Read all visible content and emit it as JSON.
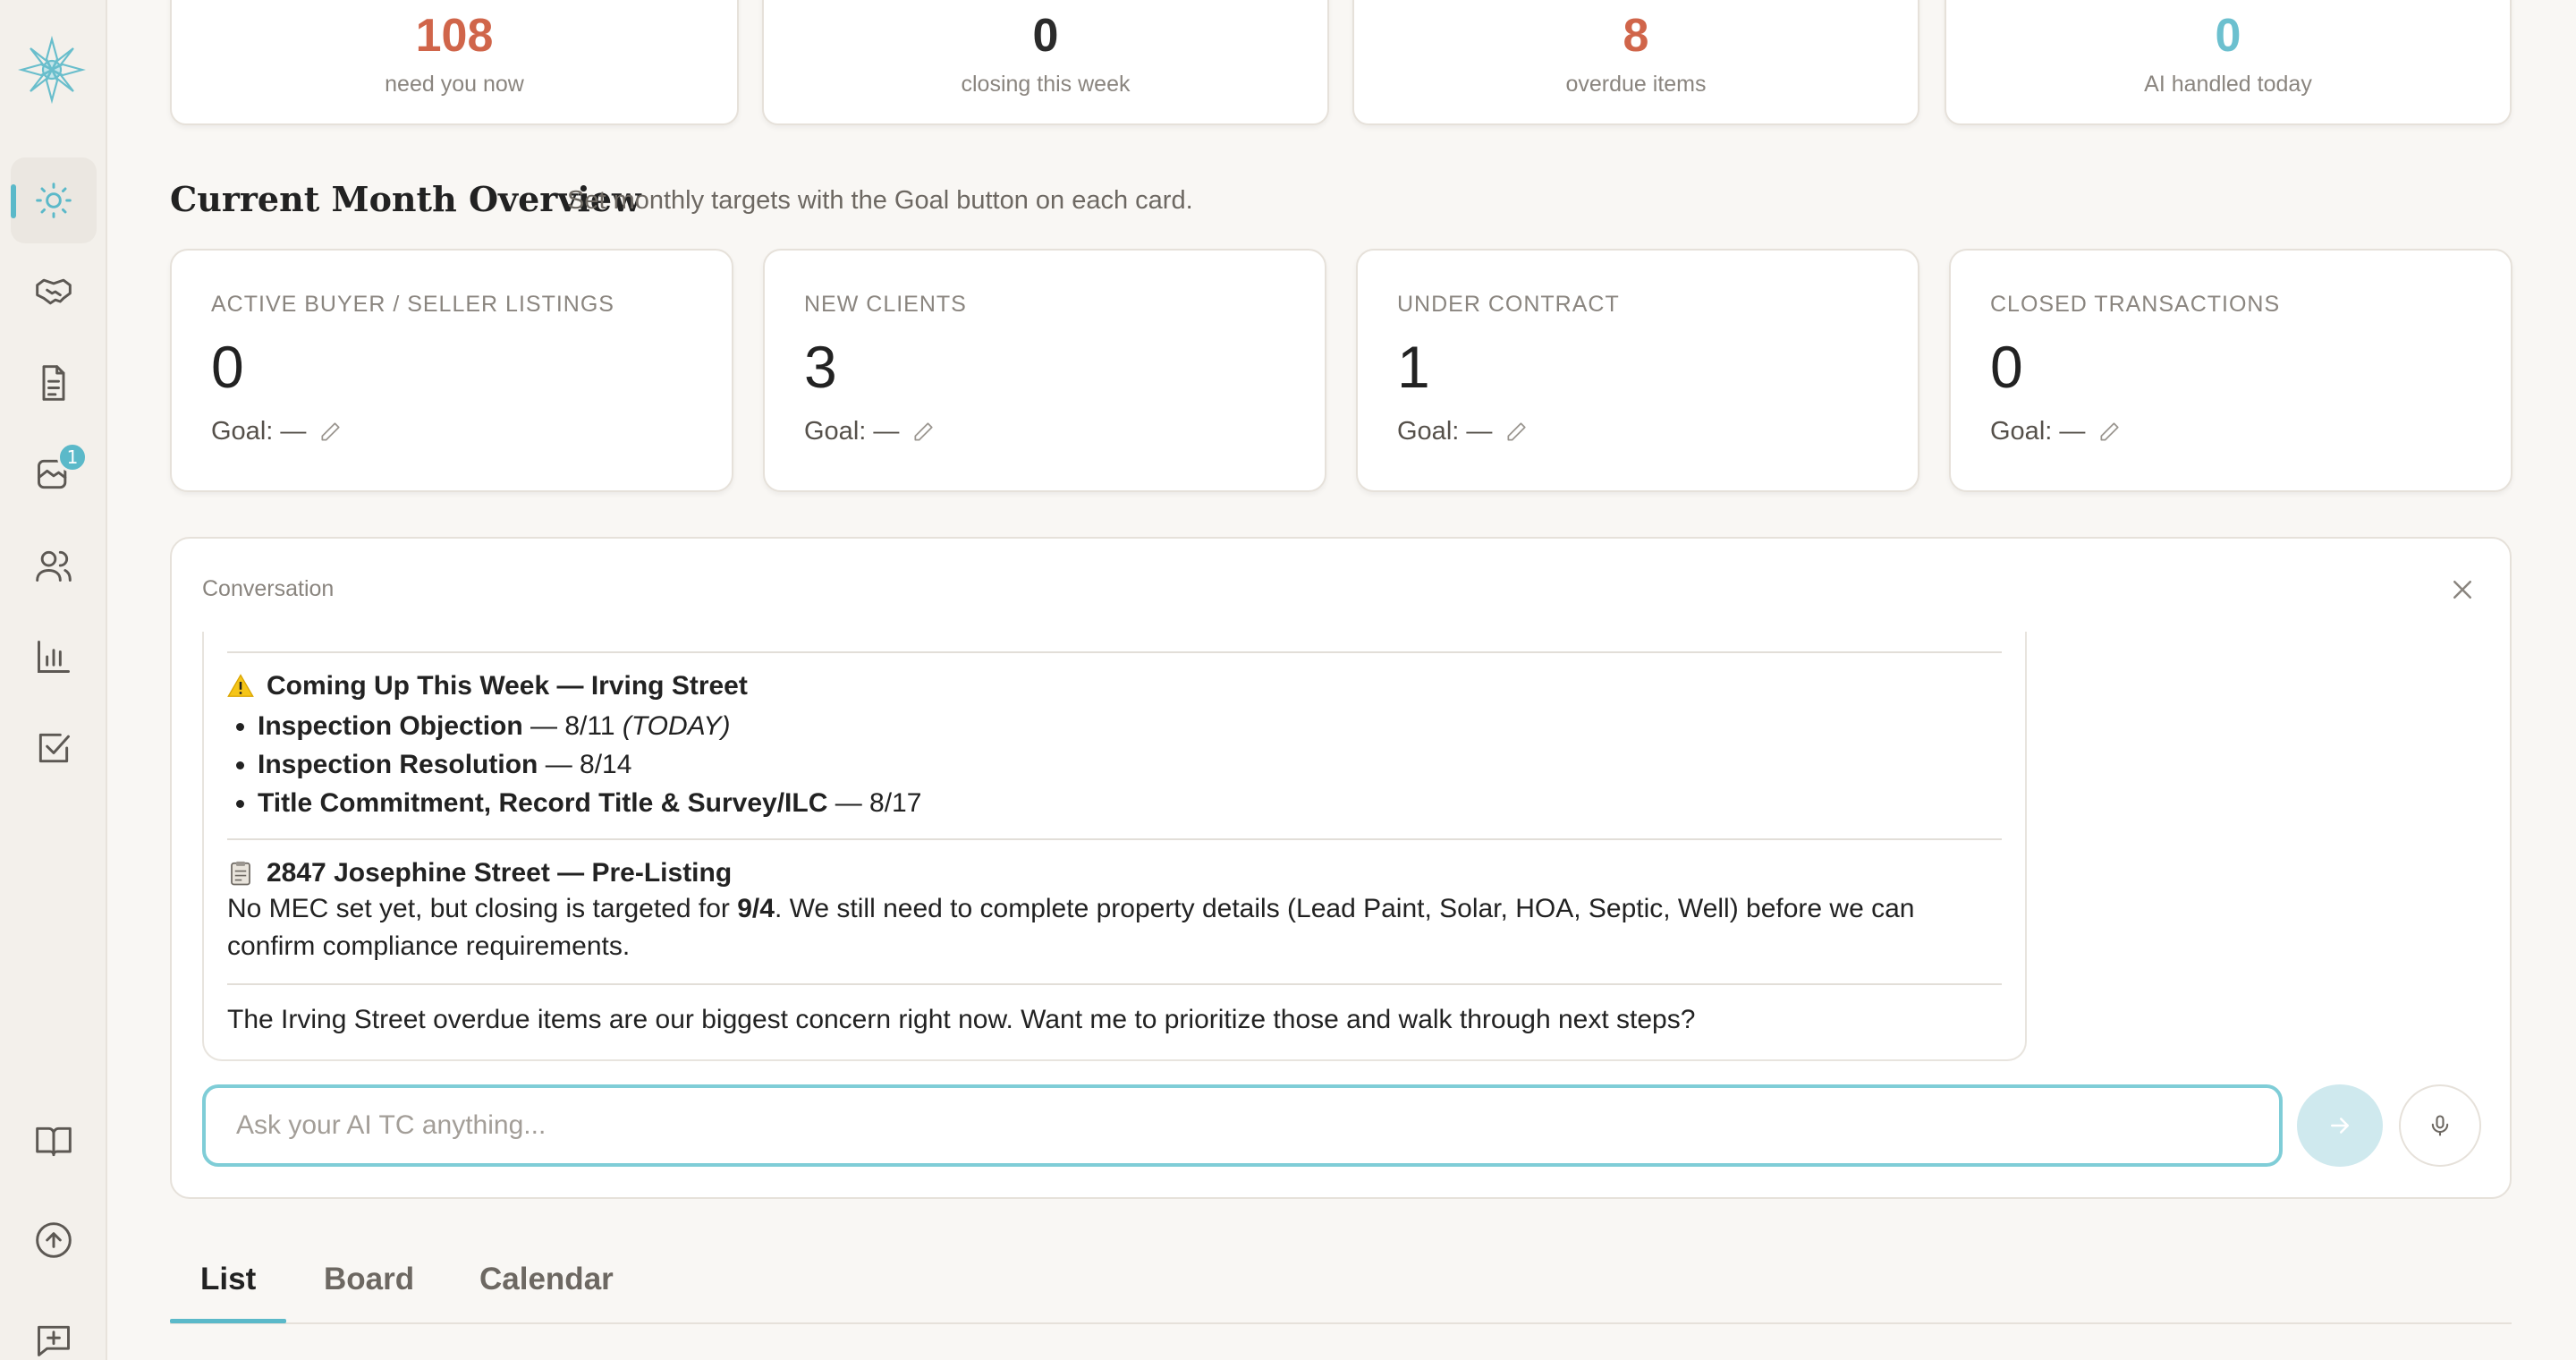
{
  "stats": [
    {
      "value": "108",
      "label": "need you now",
      "color": "#d0654a"
    },
    {
      "value": "0",
      "label": "closing this week",
      "color": "#2b2b2b"
    },
    {
      "value": "8",
      "label": "overdue items",
      "color": "#d0654a"
    },
    {
      "value": "0",
      "label": "AI handled today",
      "color": "#6cc0cf"
    }
  ],
  "overview": {
    "title": "Current Month Overview",
    "subtitle": "Set monthly targets with the Goal button on each card."
  },
  "metrics": [
    {
      "label": "ACTIVE BUYER / SELLER LISTINGS",
      "value": "0",
      "goal": "Goal: —"
    },
    {
      "label": "NEW CLIENTS",
      "value": "3",
      "goal": "Goal: —"
    },
    {
      "label": "UNDER CONTRACT",
      "value": "1",
      "goal": "Goal: —"
    },
    {
      "label": "CLOSED TRANSACTIONS",
      "value": "0",
      "goal": "Goal: —"
    }
  ],
  "sidebar": {
    "inbox_badge": "1"
  },
  "conversation": {
    "title": "Conversation",
    "section1": {
      "heading": "Coming Up This Week — Irving Street",
      "items": [
        {
          "name": "Inspection Objection",
          "date": " — 8/11 ",
          "note": "(TODAY)"
        },
        {
          "name": "Inspection Resolution",
          "date": " — 8/14",
          "note": ""
        },
        {
          "name": "Title Commitment, Record Title & Survey/ILC",
          "date": " — 8/17",
          "note": ""
        }
      ]
    },
    "section2": {
      "heading": "2847 Josephine Street — Pre-Listing",
      "text_a": "No MEC set yet, but closing is targeted for ",
      "text_bold": "9/4",
      "text_b": ". We still need to complete property details (Lead Paint, Solar, HOA, Septic, Well) before we can confirm compliance requirements."
    },
    "closing": "The Irving Street overdue items are our biggest concern right now. Want me to prioritize those and walk through next steps?",
    "input_placeholder": "Ask your AI TC anything..."
  },
  "tabs": [
    {
      "label": "List"
    },
    {
      "label": "Board"
    },
    {
      "label": "Calendar"
    }
  ]
}
